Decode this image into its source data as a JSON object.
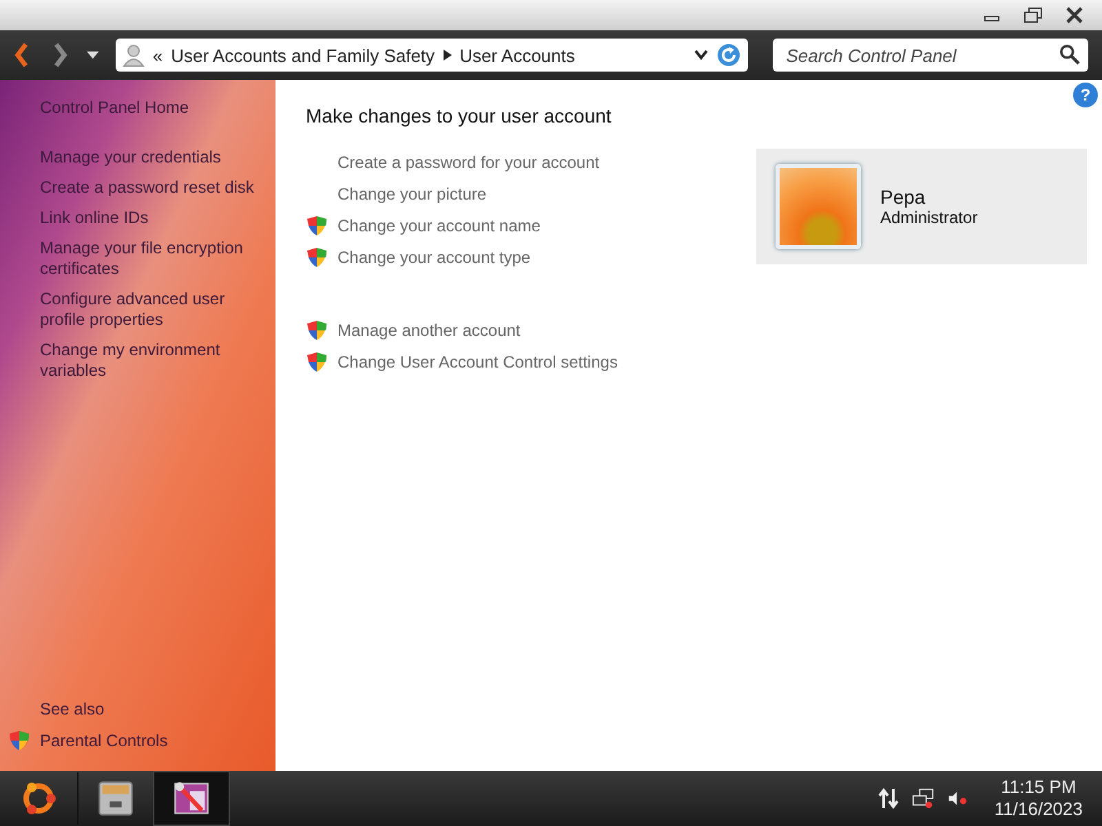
{
  "address_bar": {
    "separator": "«",
    "crumbs": [
      "User Accounts and Family Safety",
      "User Accounts"
    ]
  },
  "search": {
    "placeholder": "Search Control Panel"
  },
  "help": "?",
  "sidebar": {
    "home": "Control Panel Home",
    "items": [
      "Manage your credentials",
      "Create a password reset disk",
      "Link online IDs",
      "Manage your file encryption certificates",
      "Configure advanced user profile properties",
      "Change my environment variables"
    ],
    "see_also": {
      "heading": "See also",
      "items": [
        "Parental Controls"
      ]
    }
  },
  "main": {
    "title": "Make changes to your user account",
    "task_groups": [
      [
        {
          "label": "Create a password for your account",
          "shield": false
        },
        {
          "label": "Change your picture",
          "shield": false
        },
        {
          "label": "Change your account name",
          "shield": true
        },
        {
          "label": "Change your account type",
          "shield": true
        }
      ],
      [
        {
          "label": "Manage another account",
          "shield": true
        },
        {
          "label": "Change User Account Control settings",
          "shield": true
        }
      ]
    ],
    "account": {
      "name": "Pepa",
      "role": "Administrator"
    }
  },
  "taskbar": {
    "apps": [
      {
        "kind": "files",
        "selected": false
      },
      {
        "kind": "settings",
        "selected": true
      }
    ],
    "time": "11:15 PM",
    "date": "11/16/2023"
  }
}
